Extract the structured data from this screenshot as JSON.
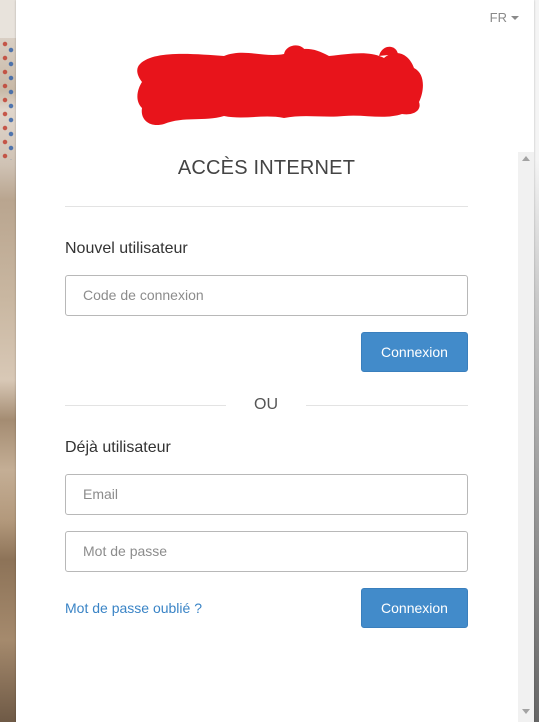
{
  "language": {
    "label": "FR"
  },
  "header": {
    "title": "ACCÈS INTERNET"
  },
  "new_user": {
    "label": "Nouvel utilisateur",
    "code_placeholder": "Code de connexion",
    "button_label": "Connexion"
  },
  "divider": {
    "label": "OU"
  },
  "existing_user": {
    "label": "Déjà utilisateur",
    "email_placeholder": "Email",
    "password_placeholder": "Mot de passe",
    "forgot_link": "Mot de passe oublié ?",
    "button_label": "Connexion"
  },
  "colors": {
    "primary_button": "#428bca",
    "link": "#3a84c6",
    "logo_redaction": "#e8141b"
  },
  "icons": {
    "language_caret": "caret-down-icon",
    "scroll_up": "arrow-up-icon",
    "scroll_down": "arrow-down-icon"
  }
}
